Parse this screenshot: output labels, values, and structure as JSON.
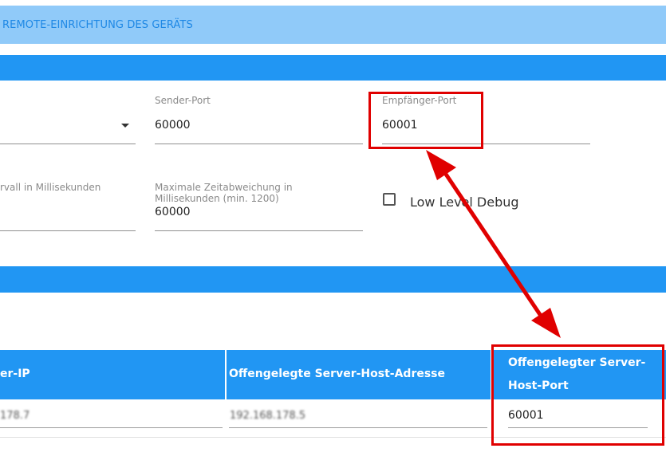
{
  "header": {
    "title": "REMOTE-EINRICHTUNG DES GERÄTS"
  },
  "settings": {
    "sender_port": {
      "label": "Sender-Port",
      "value": "60000"
    },
    "receiver_port": {
      "label": "Empfänger-Port",
      "value": "60001"
    },
    "interval": {
      "label": "rvall in Millisekunden"
    },
    "max_time_dev": {
      "label_line1": "Maximale Zeitabweichung in",
      "label_line2": "Millisekunden (min. 1200)",
      "value": "60000"
    },
    "low_level_debug": {
      "label": "Low Level Debug",
      "checked": false
    }
  },
  "table": {
    "columns": [
      "er-IP",
      "Offengelegte Server-Host-Adresse",
      "Offengelegter Server-",
      "Host-Port"
    ],
    "row": {
      "ip": "178.7",
      "host_address": "192.168.178.5",
      "host_port": "60001"
    }
  },
  "colors": {
    "accent": "#2196f3",
    "topbar": "#90caf9",
    "highlight": "#e00000"
  }
}
